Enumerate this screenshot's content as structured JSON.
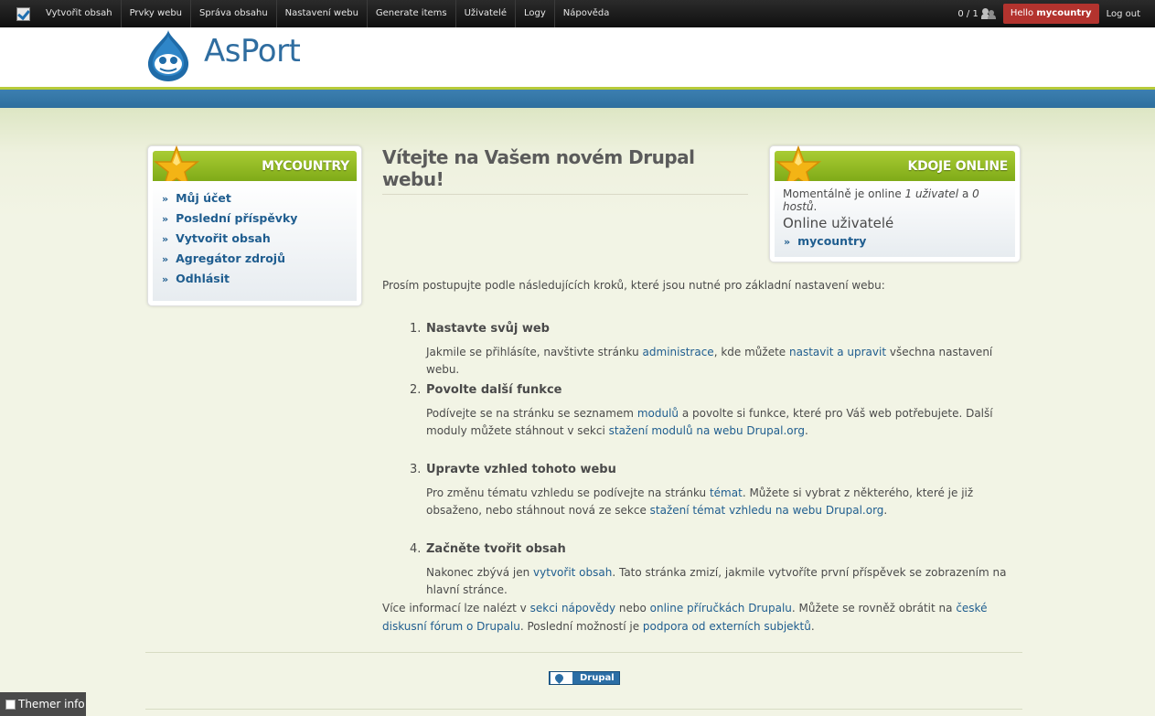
{
  "admin_bar": {
    "items": [
      "Vytvořit obsah",
      "Prvky webu",
      "Správa obsahu",
      "Nastavení webu",
      "Generate items",
      "Uživatelé",
      "Logy",
      "Nápověda"
    ],
    "user_count": "0 / 1",
    "hello_prefix": "Hello",
    "hello_user": "mycountry",
    "logout": "Log out"
  },
  "header": {
    "site_name": "AsPort"
  },
  "user_block": {
    "title": "MYCOUNTRY",
    "items": [
      "Můj účet",
      "Poslední příspěvky",
      "Vytvořit obsah",
      "Agregátor zdrojů",
      "Odhlásit"
    ]
  },
  "online_block": {
    "title": "KDOJE ONLINE",
    "status_prefix": "Momentálně je online",
    "status_users": "1 uživatel",
    "status_mid": "a",
    "status_guests": "0 hostů",
    "status_end": ".",
    "subtitle": "Online uživatelé",
    "users": [
      "mycountry"
    ]
  },
  "main": {
    "title": "Vítejte na Vašem novém Drupal webu!",
    "intro": "Prosím postupujte podle následujících kroků, které jsou nutné pro základní nastavení webu:",
    "steps": [
      {
        "num": "1.",
        "title": "Nastavte svůj web",
        "t1": "Jakmile se přihlásíte, navštivte stránku ",
        "l1": "administrace",
        "t2": ", kde můžete ",
        "l2": "nastavit a upravit",
        "t3": " všechna nastavení webu."
      },
      {
        "num": "2.",
        "title": "Povolte další funkce",
        "t1": "Podívejte se na stránku se seznamem ",
        "l1": "modulů",
        "t2": " a povolte si funkce, které pro Váš web potřebujete. Další moduly můžete stáhnout v sekci ",
        "l2": "stažení modulů na webu Drupal.org",
        "t3": "."
      },
      {
        "num": "3.",
        "title": "Upravte vzhled tohoto webu",
        "t1": "Pro změnu tématu vzhledu se podívejte na stránku ",
        "l1": "témat",
        "t2": ". Můžete si vybrat z některého, které je již obsaženo, nebo stáhnout nová ze sekce ",
        "l2": "stažení témat vzhledu na webu Drupal.org",
        "t3": "."
      },
      {
        "num": "4.",
        "title": "Začněte tvořit obsah",
        "t1": "Nakonec zbývá jen ",
        "l1": "vytvořit obsah",
        "t2": ". Tato stránka zmizí, jakmile vytvoříte první příspěvek se zobrazením na hlavní stránce.",
        "l2": "",
        "t3": ""
      }
    ],
    "more": {
      "t1": "Více informací lze nalézt v ",
      "l1": "sekci nápovědy",
      "t2": " nebo ",
      "l2": "online příručkách Drupalu",
      "t3": ". Můžete se rovněž obrátit na ",
      "l3": "české diskusní fórum o Drupalu",
      "t4": ". Poslední možností je ",
      "l4": "podpora od externích subjektů",
      "t5": "."
    }
  },
  "footer": {
    "badge": "Drupal"
  },
  "themer": {
    "label": "Themer info"
  },
  "colors": {
    "accent_green": "#8fb824",
    "brand_blue": "#2f6da0",
    "hello_red": "#b3332e"
  }
}
